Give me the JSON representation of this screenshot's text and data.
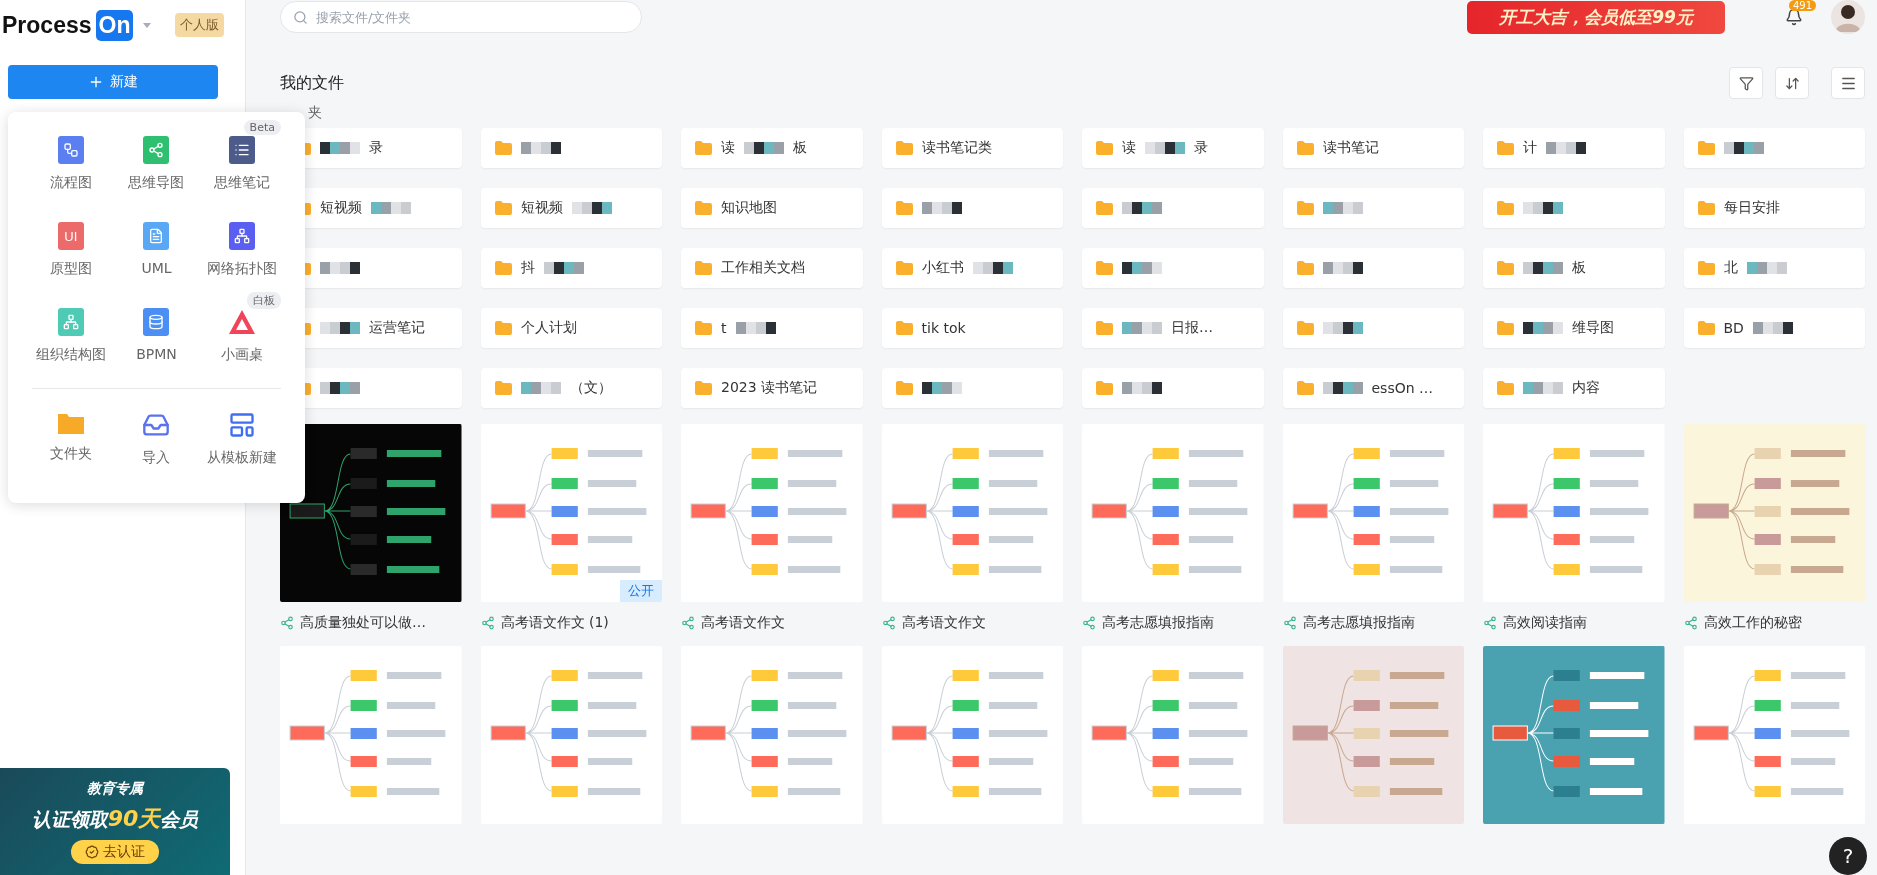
{
  "logo": {
    "word": "Process",
    "mark": "On"
  },
  "plan_badge": "个人版",
  "new_button": "新建",
  "new_menu": {
    "items": [
      {
        "kind": "flowchart",
        "label": "流程图"
      },
      {
        "kind": "mindmap",
        "label": "思维导图"
      },
      {
        "kind": "mindnote",
        "label": "思维笔记",
        "tag": "Beta"
      },
      {
        "kind": "prototype",
        "label": "原型图",
        "glyph": "UI"
      },
      {
        "kind": "uml",
        "label": "UML"
      },
      {
        "kind": "network",
        "label": "网络拓扑图"
      },
      {
        "kind": "org",
        "label": "组织结构图"
      },
      {
        "kind": "bpmn",
        "label": "BPMN"
      },
      {
        "kind": "whiteboard",
        "label": "小画桌",
        "tag": "白板"
      }
    ],
    "actions": [
      {
        "kind": "folder",
        "label": "文件夹"
      },
      {
        "kind": "import",
        "label": "导入"
      },
      {
        "kind": "template",
        "label": "从模板新建"
      }
    ]
  },
  "edu_banner": {
    "title": "教育专属",
    "offer": "认证领取**90天**会员",
    "button": "去认证"
  },
  "search": {
    "placeholder": "搜索文件/文件夹"
  },
  "promo": "开工大吉，会员低至99元",
  "notifications": {
    "count": "491"
  },
  "page_title": "我的文件",
  "folders_heading": "夹",
  "folders": [
    {
      "after": "录",
      "redacted": true
    },
    {
      "redacted": true
    },
    {
      "before": "读",
      "after": "板",
      "redacted": true
    },
    {
      "before": "读书笔记类",
      "redacted": false
    },
    {
      "before": "读",
      "after": "录",
      "redacted": true
    },
    {
      "before": "读书笔记",
      "redacted": false
    },
    {
      "before": "计",
      "redacted": true
    },
    {
      "redacted": true
    },
    {
      "before": "短视频",
      "redacted": true
    },
    {
      "before": "短视频",
      "redacted": true
    },
    {
      "before": "知识地图",
      "redacted": false
    },
    {
      "redacted": true
    },
    {
      "redacted": true
    },
    {
      "redacted": true
    },
    {
      "redacted": true
    },
    {
      "before": "每日安排",
      "redacted": false
    },
    {
      "redacted": true
    },
    {
      "before": "抖",
      "redacted": true
    },
    {
      "before": "工作相关文档",
      "redacted": false
    },
    {
      "before": "小红书",
      "redacted": true
    },
    {
      "redacted": true
    },
    {
      "redacted": true
    },
    {
      "after": "板",
      "redacted": true
    },
    {
      "before": "北",
      "redacted": true
    },
    {
      "after": "运营笔记",
      "redacted": true
    },
    {
      "before": "个人计划",
      "redacted": false
    },
    {
      "before": "t",
      "redacted": true
    },
    {
      "before": "tik tok",
      "redacted": false
    },
    {
      "after": "日报…",
      "redacted": true
    },
    {
      "redacted": true
    },
    {
      "after": "维导图",
      "redacted": true
    },
    {
      "before": "BD",
      "redacted": true
    },
    {
      "redacted": true
    },
    {
      "after": "（文）",
      "redacted": true
    },
    {
      "before": "2023 读书笔记",
      "redacted": false
    },
    {
      "redacted": true
    },
    {
      "redacted": true
    },
    {
      "after": "essOn …",
      "redacted": true
    },
    {
      "after": "内容",
      "redacted": true
    }
  ],
  "files": [
    {
      "title": "高质量独处可以做…",
      "color": "#060606"
    },
    {
      "title": "高考语文作文 (1)",
      "color": "#ffffff",
      "badge": "公开"
    },
    {
      "title": "高考语文作文",
      "color": "#ffffff"
    },
    {
      "title": "高考语文作文",
      "color": "#ffffff"
    },
    {
      "title": "高考志愿填报指南",
      "color": "#ffffff"
    },
    {
      "title": "高考志愿填报指南",
      "color": "#ffffff"
    },
    {
      "title": "高效阅读指南",
      "color": "#ffffff"
    },
    {
      "title": "高效工作的秘密",
      "color": "#fbf5dc"
    },
    {
      "color": "#ffffff"
    },
    {
      "color": "#ffffff"
    },
    {
      "color": "#ffffff"
    },
    {
      "color": "#ffffff"
    },
    {
      "color": "#ffffff"
    },
    {
      "color": "#efe3e3"
    },
    {
      "color": "#4aa1b0"
    },
    {
      "color": "#ffffff"
    }
  ],
  "help": "?"
}
